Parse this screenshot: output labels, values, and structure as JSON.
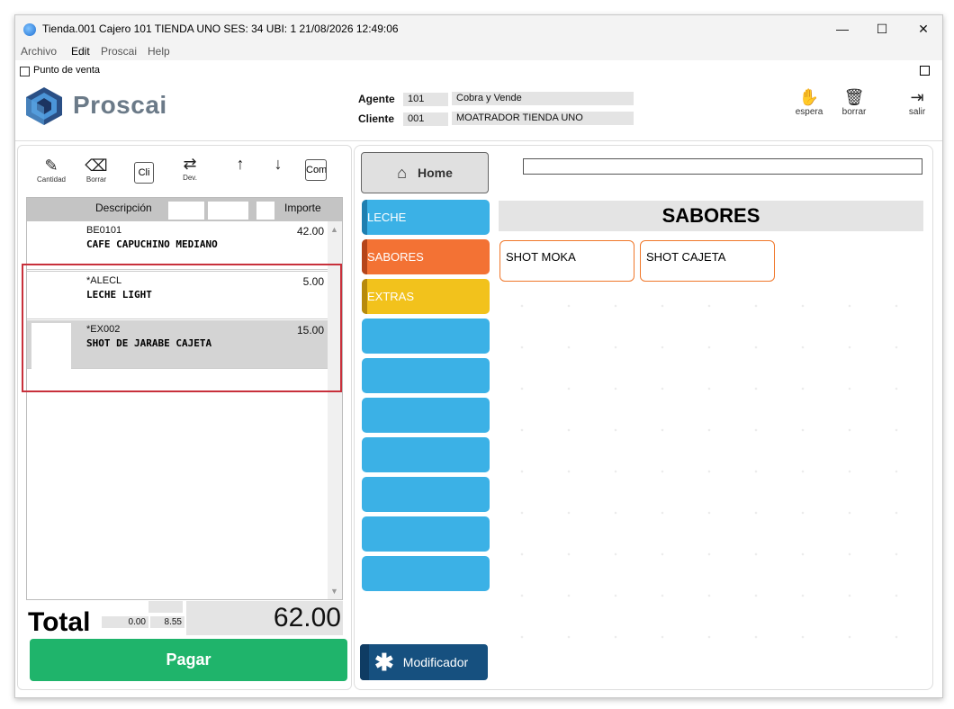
{
  "titlebar": {
    "title": "Tienda.001  Cajero 101  TIENDA UNO    SES: 34   UBI: 1   21/08/2026 12:49:06",
    "minimize": "—",
    "maximize": "☐",
    "close": "✕"
  },
  "menu": [
    "Archivo",
    "Edit",
    "Proscai",
    "Help"
  ],
  "subheader": {
    "window_label": "Punto de venta",
    "logo_text": "Proscai",
    "agente_label": "Agente",
    "agente_code": "101",
    "agente_name": "Cobra y Vende",
    "cliente_label": "Cliente",
    "cliente_code": "001",
    "cliente_name": "MOATRADOR TIENDA UNO",
    "tools": [
      {
        "label": "espera",
        "icon": "hand-icon"
      },
      {
        "label": "borrar",
        "icon": "trash-icon"
      },
      {
        "label": "salir",
        "icon": "exit-icon"
      }
    ]
  },
  "toolbar": {
    "cantidad": "Cantidad",
    "borrar": "Borrar",
    "cli": "Cli",
    "dev": "Dev.",
    "com": "Com"
  },
  "grid": {
    "col_descripcion": "Descripción",
    "col_importe": "Importe",
    "rows": [
      {
        "code": "BE0101",
        "desc": "CAFE CAPUCHINO MEDIANO",
        "amount": "42.00"
      },
      {
        "code": "*ALECL",
        "desc": "LECHE LIGHT",
        "amount": "5.00"
      },
      {
        "code": "*EX002",
        "desc": "SHOT DE JARABE CAJETA",
        "amount": "15.00"
      }
    ]
  },
  "totals": {
    "label": "Total",
    "mini1": "0.00",
    "mini2": "8.55",
    "total": "62.00",
    "pay": "Pagar"
  },
  "catalog": {
    "home": "Home",
    "categories": [
      {
        "label": "LECHE",
        "color": "#3bb1e6",
        "edge": "#1f7fb0"
      },
      {
        "label": "SABORES",
        "color": "#f37234",
        "edge": "#b5451a"
      },
      {
        "label": "EXTRAS",
        "color": "#f2c21c",
        "edge": "#b78a0c"
      }
    ],
    "section_title": "SABORES",
    "products": [
      "SHOT MOKA",
      "SHOT CAJETA"
    ],
    "modificador": "Modificador"
  }
}
